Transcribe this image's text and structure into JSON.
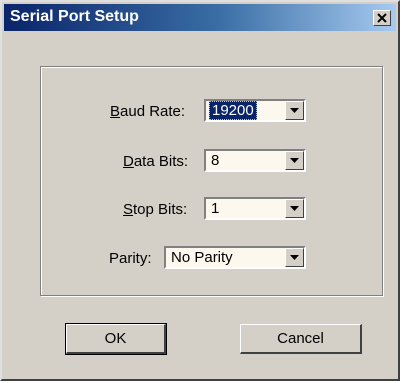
{
  "window": {
    "title": "Serial Port Setup",
    "close_icon": "close-x-icon"
  },
  "fields": {
    "baud_rate": {
      "label_accel": "B",
      "label_rest": "aud Rate:",
      "value": "19200"
    },
    "data_bits": {
      "label_accel": "D",
      "label_rest": "ata Bits:",
      "value": "8"
    },
    "stop_bits": {
      "label_accel": "S",
      "label_rest": "top Bits:",
      "value": "1"
    },
    "parity": {
      "label": "Parity:",
      "value": "No Parity"
    }
  },
  "buttons": {
    "ok": "OK",
    "cancel": "Cancel"
  },
  "colors": {
    "dialog_face": "#d4d0c8",
    "title_gradient_start": "#0a246a",
    "title_gradient_end": "#a6caf0",
    "combo_field": "#fdf8ee",
    "selection": "#0a246a"
  }
}
